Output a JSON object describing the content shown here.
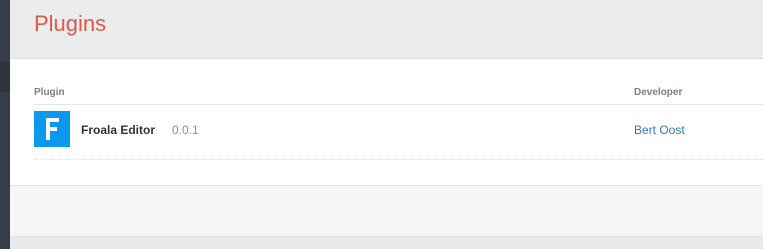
{
  "page": {
    "title": "Plugins"
  },
  "table": {
    "columns": {
      "plugin": "Plugin",
      "developer": "Developer"
    },
    "rows": [
      {
        "icon": "froala-logo-icon",
        "name": "Froala Editor",
        "version": "0.0.1",
        "developer": "Bert Oost"
      }
    ]
  },
  "colors": {
    "title": "#e2574c",
    "link": "#2f78c9",
    "logo_bg": "#0c98ee",
    "rail": "#373d48"
  }
}
